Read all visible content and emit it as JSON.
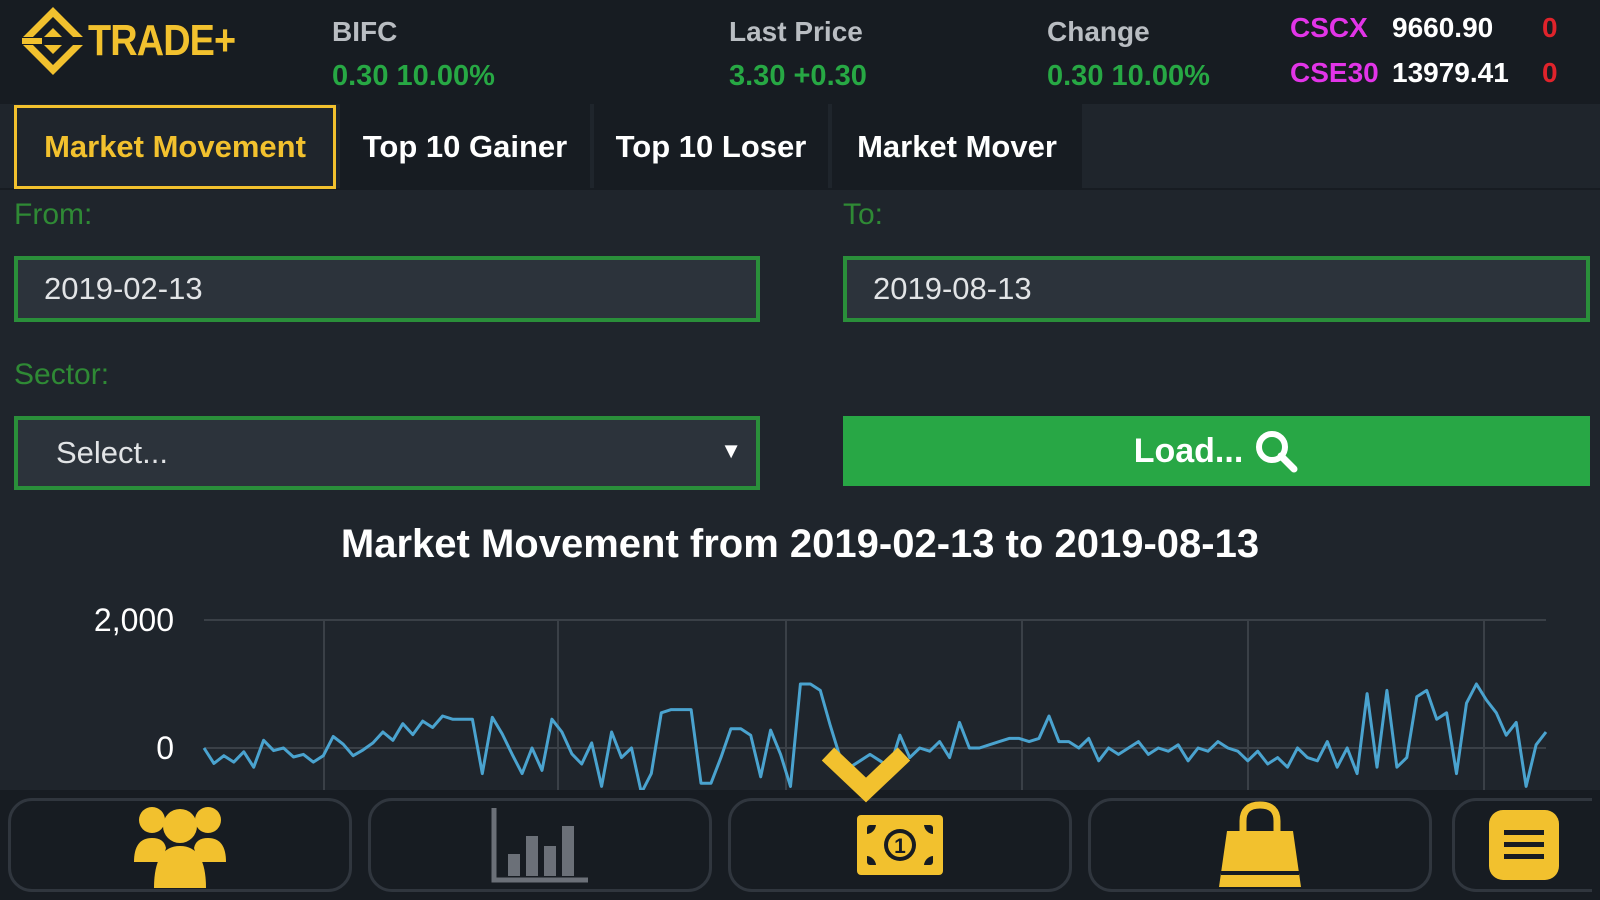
{
  "header": {
    "logo_text": "TRADE+",
    "stock_symbol": "BIFC",
    "stock_value": "0.30 10.00%",
    "last_price_label": "Last Price",
    "last_price_value": "3.30 +0.30",
    "change_label": "Change",
    "change_value": "0.30 10.00%",
    "indices": [
      {
        "name": "CSCX",
        "value": "9660.90",
        "change": "0"
      },
      {
        "name": "CSE30",
        "value": "13979.41",
        "change": "0"
      }
    ]
  },
  "tabs": [
    {
      "label": "Market Movement",
      "active": true
    },
    {
      "label": "Top 10 Gainer",
      "active": false
    },
    {
      "label": "Top 10 Loser",
      "active": false
    },
    {
      "label": "Market Mover",
      "active": false
    }
  ],
  "form": {
    "from_label": "From:",
    "from_value": "2019-02-13",
    "to_label": "To:",
    "to_value": "2019-08-13",
    "sector_label": "Sector:",
    "sector_value": "Select...",
    "load_label": "Load..."
  },
  "chart_data": {
    "type": "line",
    "title": "Market Movement from 2019-02-13 to 2019-08-13",
    "ylim": [
      -700,
      2000
    ],
    "yticks": [
      "2,000",
      "0"
    ],
    "ytick_values": [
      2000,
      0
    ],
    "grid": true,
    "series": [
      {
        "values": [
          0,
          -240,
          -120,
          -220,
          -60,
          -300,
          120,
          -40,
          0,
          -140,
          -100,
          -220,
          -120,
          180,
          60,
          -120,
          -30,
          80,
          250,
          120,
          380,
          210,
          420,
          320,
          500,
          450,
          450,
          450,
          -400,
          480,
          220,
          -100,
          -400,
          0,
          -350,
          450,
          250,
          -90,
          -250,
          80,
          -600,
          250,
          -150,
          0,
          -700,
          -400,
          550,
          600,
          600,
          600,
          -550,
          -550,
          -150,
          300,
          300,
          200,
          -450,
          280,
          -100,
          -600,
          1000,
          1000,
          900,
          350,
          -150,
          -300,
          -200,
          -100,
          -200,
          -300,
          200,
          -150,
          0,
          -50,
          100,
          -150,
          400,
          0,
          0,
          50,
          100,
          150,
          150,
          100,
          150,
          500,
          100,
          100,
          0,
          150,
          -200,
          0,
          -100,
          0,
          100,
          -100,
          0,
          -50,
          50,
          -200,
          0,
          -50,
          100,
          0,
          -50,
          -200,
          -50,
          -250,
          -150,
          -300,
          0,
          -150,
          -200,
          100,
          -300,
          0,
          -400,
          850,
          -300,
          900,
          -300,
          -150,
          800,
          900,
          450,
          550,
          -400,
          700,
          1000,
          750,
          550,
          200,
          400,
          -600,
          50,
          250
        ]
      }
    ]
  },
  "nav": {
    "items": [
      "people-icon",
      "bar-chart-icon",
      "money-icon",
      "shopping-bag-icon",
      "menu-icon"
    ],
    "accent": "#f2c12e",
    "inactive": "#6b7078"
  }
}
